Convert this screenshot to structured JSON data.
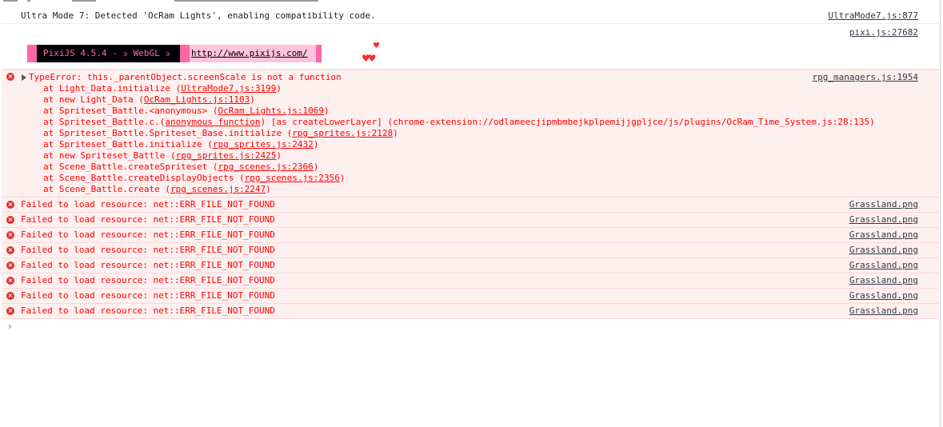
{
  "console": {
    "info_line": {
      "message": "Ultra Mode 7: Detected 'OcRam Lights', enabling compatibility code.",
      "source": "UltraMode7.js:877"
    },
    "pixi_source": "pixi.js:27682",
    "banner": {
      "label": "PixiJS 4.5.4 - ✰ WebGL ✰",
      "url": "http://www.pixijs.com/",
      "heart_top": "♥",
      "hearts_bottom": "♥♥"
    },
    "type_error": {
      "message": "TypeError: this._parentObject.screenScale is not a function",
      "source": "rpg_managers.js:1954",
      "stack": [
        {
          "text": "at Light_Data.initialize (",
          "link": "UltraMode7.js:3199",
          "suffix": ")"
        },
        {
          "text": "at new Light_Data (",
          "link": "OcRam_Lights.js:1103",
          "suffix": ")"
        },
        {
          "text": "at Spriteset_Battle.<anonymous> (",
          "link": "OcRam_Lights.js:1069",
          "suffix": ")"
        },
        {
          "text": "at Spriteset_Battle.c.(",
          "link": "anonymous function",
          "suffix": ") [as createLowerLayer] (chrome-extension://odlameecjipmbmbejkplpemijjgpljce/js/plugins/OcRam_Time_System.js:28:135)"
        },
        {
          "text": "at Spriteset_Battle.Spriteset_Base.initialize (",
          "link": "rpg_sprites.js:2128",
          "suffix": ")"
        },
        {
          "text": "at Spriteset_Battle.initialize (",
          "link": "rpg_sprites.js:2432",
          "suffix": ")"
        },
        {
          "text": "at new Spriteset_Battle (",
          "link": "rpg_sprites.js:2425",
          "suffix": ")"
        },
        {
          "text": "at Scene_Battle.createSpriteset (",
          "link": "rpg_scenes.js:2366",
          "suffix": ")"
        },
        {
          "text": "at Scene_Battle.createDisplayObjects (",
          "link": "rpg_scenes.js:2356",
          "suffix": ")"
        },
        {
          "text": "at Scene_Battle.create (",
          "link": "rpg_scenes.js:2247",
          "suffix": ")"
        }
      ]
    },
    "resource_errors": [
      {
        "message": "Failed to load resource: net::ERR_FILE_NOT_FOUND",
        "source": "Grassland.png"
      },
      {
        "message": "Failed to load resource: net::ERR_FILE_NOT_FOUND",
        "source": "Grassland.png"
      },
      {
        "message": "Failed to load resource: net::ERR_FILE_NOT_FOUND",
        "source": "Grassland.png"
      },
      {
        "message": "Failed to load resource: net::ERR_FILE_NOT_FOUND",
        "source": "Grassland.png"
      },
      {
        "message": "Failed to load resource: net::ERR_FILE_NOT_FOUND",
        "source": "Grassland.png"
      },
      {
        "message": "Failed to load resource: net::ERR_FILE_NOT_FOUND",
        "source": "Grassland.png"
      },
      {
        "message": "Failed to load resource: net::ERR_FILE_NOT_FOUND",
        "source": "Grassland.png"
      },
      {
        "message": "Failed to load resource: net::ERR_FILE_NOT_FOUND",
        "source": "Grassland.png"
      }
    ],
    "prompt_symbol": "›",
    "error_icon_glyph": "×",
    "colors": {
      "error_text": "#ff0000",
      "error_bg": "#fff0f0",
      "banner_pink": "#ff66a5",
      "banner_dark": "#030307",
      "banner_light": "#ffc3dc",
      "prompt_blue": "#2f74d0"
    }
  }
}
